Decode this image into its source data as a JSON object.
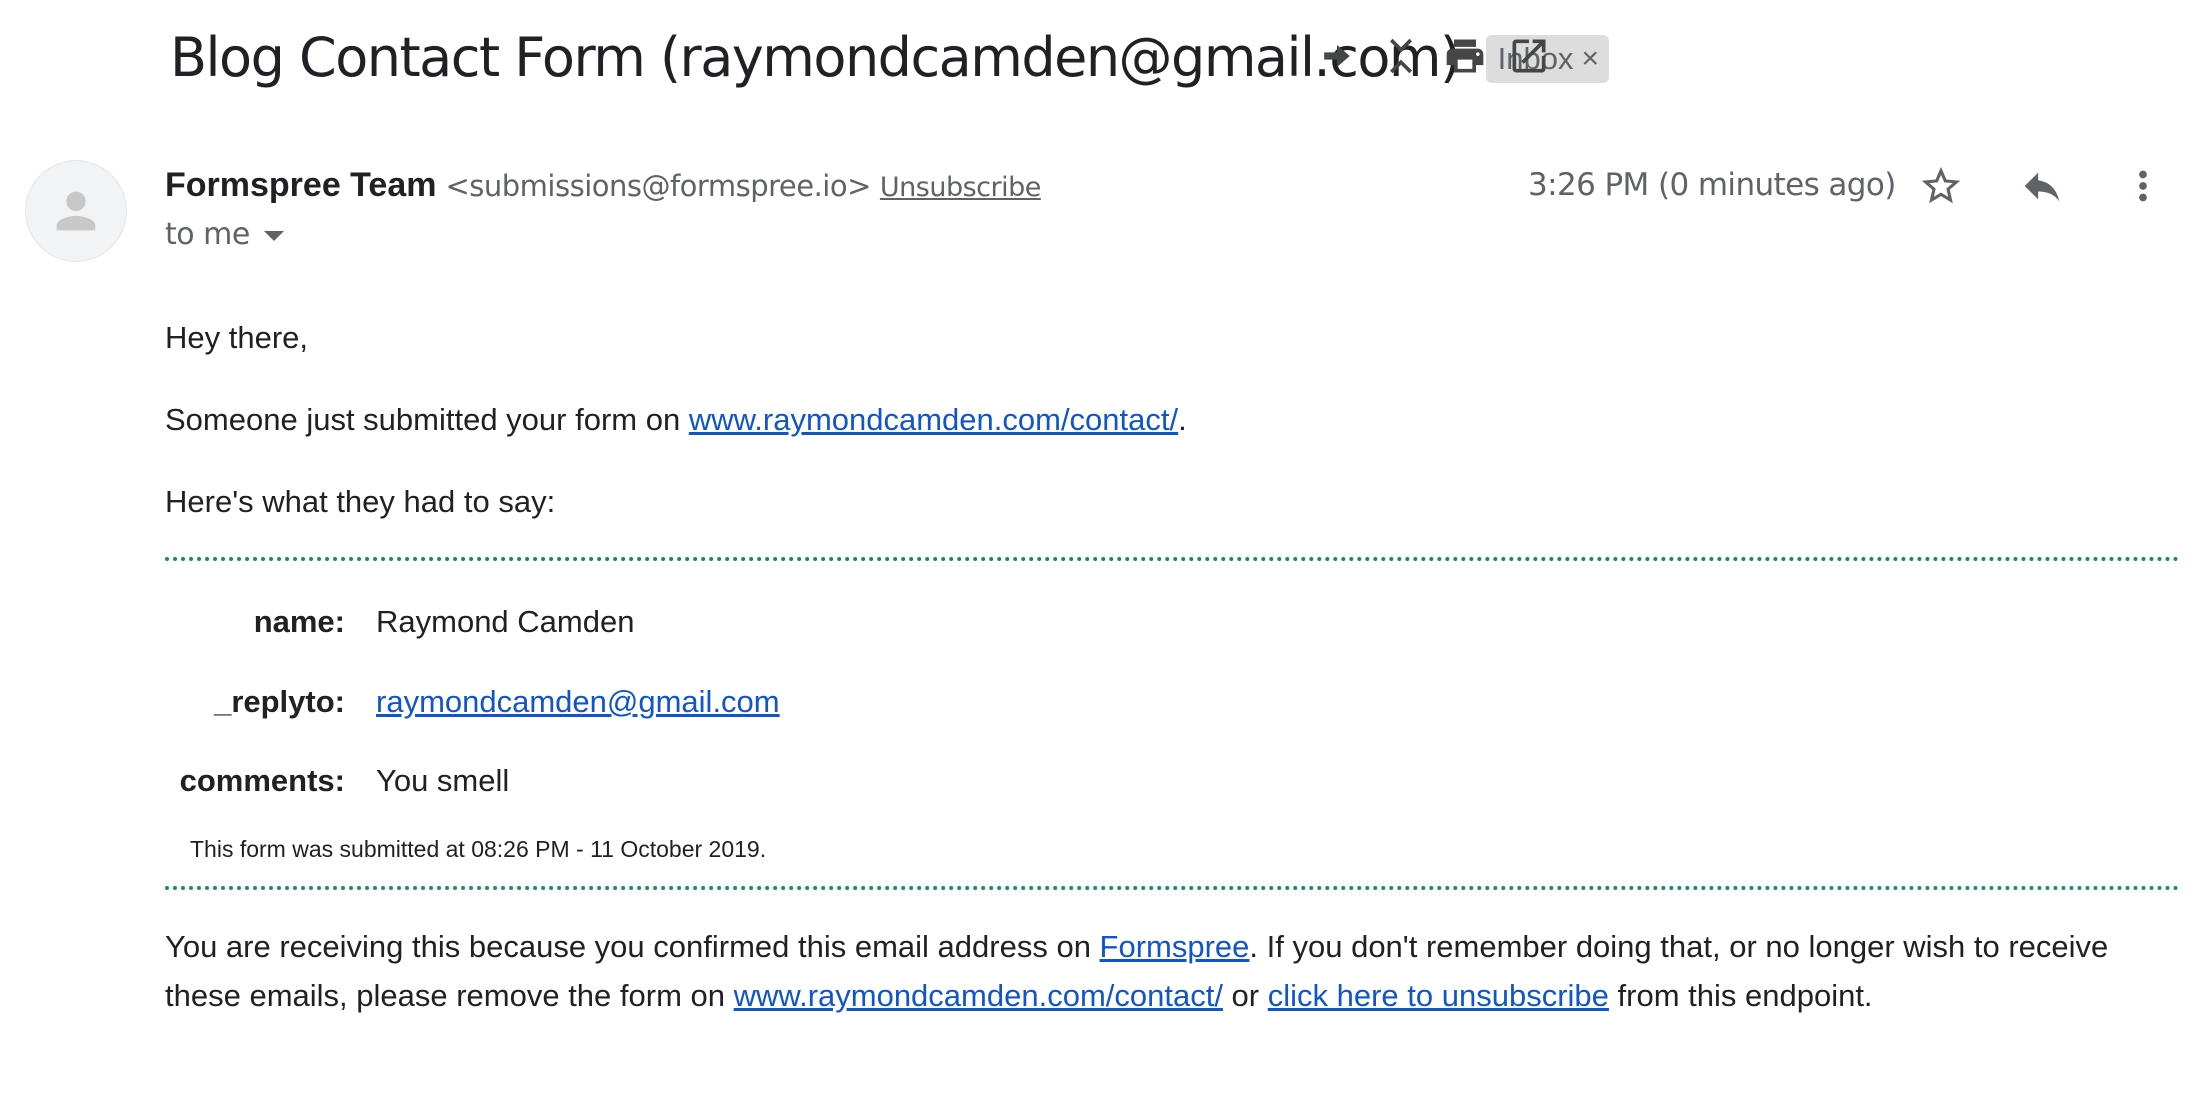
{
  "subject": {
    "title": "Blog Contact Form (raymondcamden@gmail.com)",
    "label": "Inbox",
    "label_remove_glyph": "×"
  },
  "toolbar": {
    "icons": [
      "forward-arrow-icon",
      "collapse-icon",
      "print-icon",
      "open-in-new-window-icon"
    ]
  },
  "sender": {
    "name": "Formspree Team",
    "email": "<submissions@formspree.io>",
    "unsubscribe": "Unsubscribe",
    "to": "to me",
    "timestamp": "3:26 PM (0 minutes ago)"
  },
  "message_actions": {
    "icons": [
      "star-icon",
      "reply-icon",
      "more-vert-icon"
    ]
  },
  "body": {
    "greeting": "Hey there,",
    "intro_prefix": "Someone just submitted your form on ",
    "intro_link": "www.raymondcamden.com/contact/",
    "intro_suffix": ".",
    "lead": "Here's what they had to say:",
    "fields": [
      {
        "label": "name:",
        "value": "Raymond Camden"
      },
      {
        "label": "_replyto:",
        "value": "raymondcamden@gmail.com"
      },
      {
        "label": "comments:",
        "value": "You smell"
      }
    ],
    "submitted_note": "This form was submitted at 08:26 PM - 11 October 2019."
  },
  "footer": {
    "part1": "You are receiving this because you confirmed this email address on ",
    "formspree_link": "Formspree",
    "part2": ". If you don't remember doing that, or no longer wish to receive these emails, please remove the form on ",
    "site_link": "www.raymondcamden.com/contact/",
    "part3": " or ",
    "unsubscribe_link": "click here to unsubscribe",
    "part4": " from this endpoint."
  },
  "colors": {
    "link": "#1155cc",
    "divider": "#1a8a6a",
    "chip_bg": "#dddddd",
    "secondary_text": "#5f6368"
  }
}
